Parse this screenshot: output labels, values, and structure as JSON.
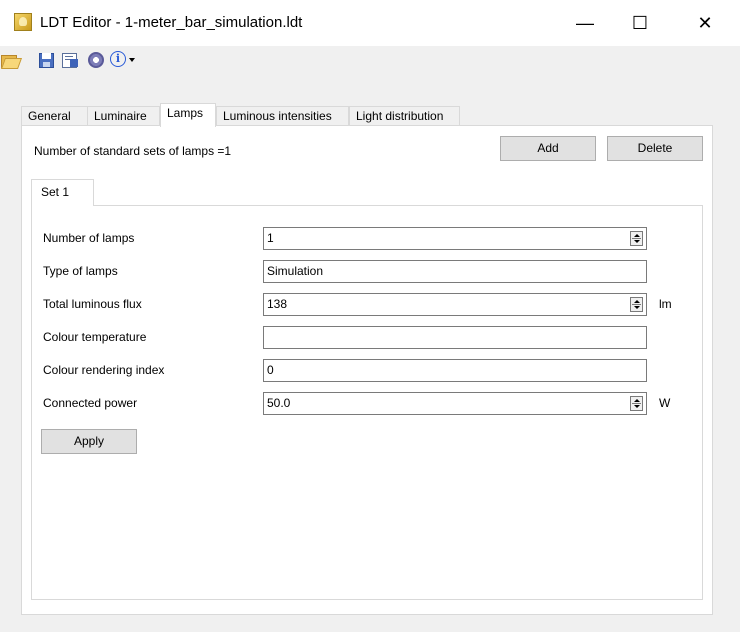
{
  "window": {
    "title": "LDT Editor - 1-meter_bar_simulation.ldt",
    "minimize_glyph": "—",
    "maximize_glyph": "☐",
    "close_glyph": "✕"
  },
  "toolbar": {
    "icons": [
      "open-folder-icon",
      "save-icon",
      "save-as-icon",
      "settings-gear-icon",
      "info-icon"
    ],
    "info_glyph": "i"
  },
  "tabs": [
    {
      "label": "General",
      "active": false
    },
    {
      "label": "Luminaire",
      "active": false
    },
    {
      "label": "Lamps",
      "active": true
    },
    {
      "label": "Luminous intensities",
      "active": false
    },
    {
      "label": "Light distribution",
      "active": false
    }
  ],
  "lamps": {
    "sets_label": "Number of standard sets of lamps =1",
    "add_label": "Add",
    "delete_label": "Delete",
    "set_tab_label": "Set 1",
    "fields": {
      "number_of_lamps": {
        "label": "Number of lamps",
        "value": "1"
      },
      "type_of_lamps": {
        "label": "Type of lamps",
        "value": "Simulation"
      },
      "total_luminous_flux": {
        "label": "Total luminous flux",
        "value": "138",
        "unit": "lm"
      },
      "colour_temperature": {
        "label": "Colour temperature",
        "value": ""
      },
      "colour_rendering_index": {
        "label": "Colour rendering index",
        "value": "0"
      },
      "connected_power": {
        "label": "Connected power",
        "value": "50.0",
        "unit": "W"
      }
    },
    "apply_label": "Apply"
  }
}
